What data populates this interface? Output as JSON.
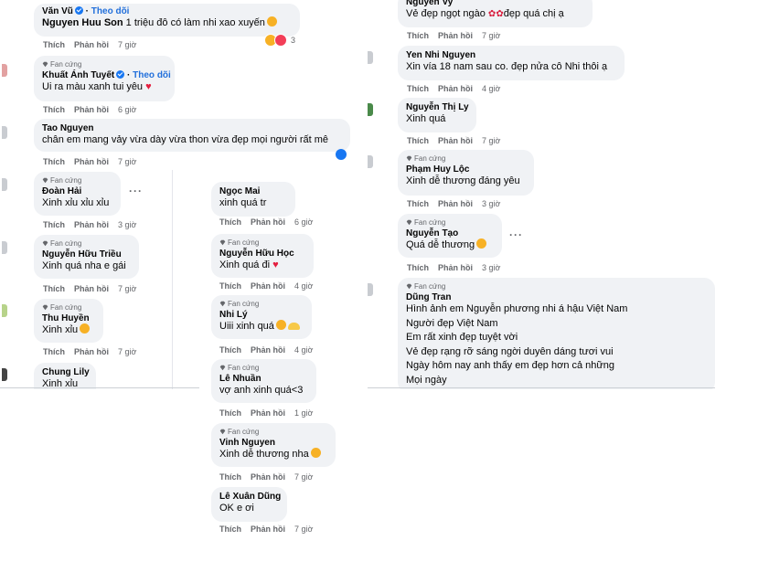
{
  "actions": {
    "like": "Thích",
    "reply": "Phản hồi"
  },
  "badge_label": "Fan cứng",
  "left": {
    "c1": {
      "name": "Văn Vũ",
      "follow": "Theo dõi",
      "mention": "Nguyen Huu Son",
      "text": " 1 triệu đô có làm nhi xao xuyến",
      "time": "7 giờ",
      "react_count": "3"
    },
    "c2": {
      "name": "Khuất Ánh Tuyết",
      "follow": "Theo dõi",
      "text": "Ui ra màu xanh tui yêu",
      "time": "6 giờ"
    },
    "c3": {
      "name": "Tao Nguyen",
      "text": "chân em mang vảy vừa dày vừa thon vừa đẹp mọi người rất mê",
      "time": "7 giờ"
    },
    "c4": {
      "name": "Đoàn Hải",
      "text": "Xinh xỉu xỉu xỉu",
      "time": "3 giờ"
    },
    "c5": {
      "name": "Nguyễn Hữu Triều",
      "text": "Xinh quá nha e gái",
      "time": "7 giờ"
    },
    "c6": {
      "name": "Thu Huyền",
      "text": "Xinh xỉu",
      "time": "7 giờ"
    },
    "c7": {
      "name": "Chung Lily",
      "text": "Xinh xỉu"
    }
  },
  "mid": {
    "c1": {
      "name": "Ngọc Mai",
      "text": "xinh quá tr",
      "time": "6 giờ"
    },
    "c2": {
      "name": "Nguyễn Hữu Học",
      "text": "Xinh quá đi",
      "time": "4 giờ"
    },
    "c3": {
      "name": "Nhi Lý",
      "text": "Uiii xinh quá",
      "time": "4 giờ"
    },
    "c4": {
      "name": "Lê Nhuần",
      "text": "vợ anh xinh quá<3",
      "time": "1 giờ"
    },
    "c5": {
      "name": "Vinh Nguyen",
      "text": "Xinh dễ thương nha",
      "time": "7 giờ"
    },
    "c6": {
      "name": "Lê Xuân Dũng",
      "text": "OK e ơi",
      "time": "7 giờ"
    }
  },
  "right": {
    "c1": {
      "name": "Nguyễn Vy",
      "text_a": "Vẻ đẹp ngọt ngào ",
      "text_b": "đẹp quá chị ạ",
      "time": "7 giờ"
    },
    "c2": {
      "name": "Yen Nhi Nguyen",
      "text": "Xin vía 18 nam sau co. đẹp nửa cô Nhi thôi ạ",
      "time": "4 giờ"
    },
    "c3": {
      "name": "Nguyễn Thị Ly",
      "text": "Xinh quá",
      "time": "7 giờ"
    },
    "c4": {
      "name": "Phạm Huy Lộc",
      "text": "Xinh dễ thương đáng yêu",
      "time": "3 giờ"
    },
    "c5": {
      "name": "Nguyễn Tạo",
      "text": "Quá dễ thương",
      "time": "3 giờ"
    },
    "c6": {
      "name": "Dũng Tran",
      "lines": [
        "Hình ảnh em Nguyễn phương nhi á hậu Việt Nam",
        "Người đẹp Việt Nam",
        "Em rất xinh đẹp tuyệt vời",
        "Vẻ đẹp rạng rỡ sáng ngời duyên dáng tươi vui",
        "Ngày hôm nay anh thấy em đẹp hơn cả những",
        "Mọi ngày"
      ]
    }
  },
  "icons": {
    "badge": "diamond-icon",
    "verified": "verified-check-icon",
    "more": "more-options-icon",
    "heart": "heart-emoji",
    "rose": "rose-emoji",
    "love_face": "smiling-face-with-hearts-emoji"
  },
  "colors": {
    "bubble": "#f0f2f5",
    "meta": "#65676b",
    "link": "#216fdb",
    "heart": "#e41e3f"
  }
}
